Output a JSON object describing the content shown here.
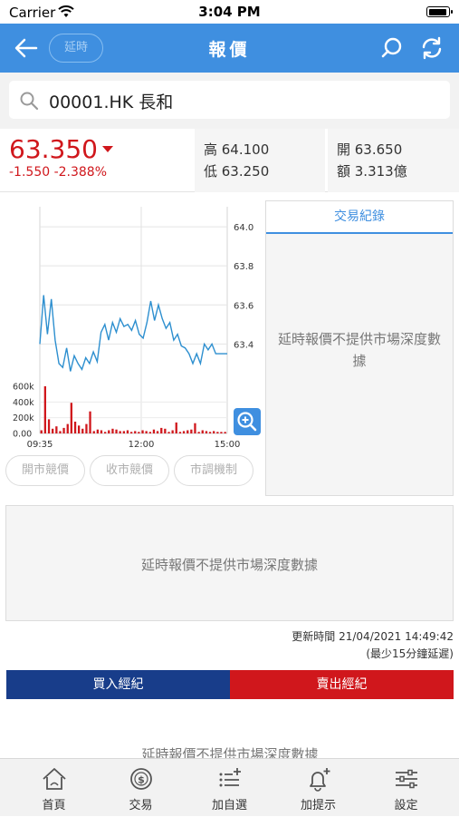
{
  "status_bar": {
    "carrier": "Carrier",
    "time": "3:04 PM"
  },
  "nav": {
    "delay_label": "延時",
    "title": "報價"
  },
  "search": {
    "value": "00001.HK 長和"
  },
  "quote": {
    "price": "63.350",
    "change": "-1.550 -2.388%",
    "high": "高 64.100",
    "low": "低 63.250",
    "open": "開 63.650",
    "turnover": "額 3.313億"
  },
  "chart_data": {
    "type": "line",
    "x_ticks": [
      "09:35",
      "12:00",
      "15:00"
    ],
    "price_ticks": [
      "64.0",
      "63.8",
      "63.6",
      "63.4"
    ],
    "volume_ticks": [
      "600k",
      "400k",
      "200k",
      "0.00"
    ],
    "price_ylim": [
      63.23,
      64.07
    ],
    "volume_ylim": [
      0,
      600000
    ],
    "price_series": [
      63.4,
      63.65,
      63.45,
      63.63,
      63.42,
      63.3,
      63.28,
      63.38,
      63.26,
      63.34,
      63.3,
      63.27,
      63.33,
      63.3,
      63.36,
      63.31,
      63.46,
      63.5,
      63.42,
      63.51,
      63.46,
      63.53,
      63.49,
      63.5,
      63.47,
      63.52,
      63.45,
      63.43,
      63.51,
      63.62,
      63.52,
      63.6,
      63.53,
      63.48,
      63.51,
      63.42,
      63.45,
      63.39,
      63.38,
      63.35,
      63.3,
      63.35,
      63.3,
      63.4,
      63.37,
      63.4,
      63.35,
      63.35,
      63.35,
      63.35
    ],
    "volume_series": [
      40000,
      620000,
      180000,
      60000,
      90000,
      30000,
      70000,
      120000,
      390000,
      150000,
      100000,
      60000,
      120000,
      280000,
      30000,
      50000,
      40000,
      20000,
      40000,
      60000,
      50000,
      30000,
      30000,
      40000,
      20000,
      30000,
      20000,
      40000,
      30000,
      20000,
      50000,
      30000,
      70000,
      60000,
      20000,
      40000,
      140000,
      20000,
      30000,
      40000,
      50000,
      130000,
      20000,
      40000,
      30000,
      20000,
      30000,
      20000,
      20000,
      20000
    ],
    "colors": {
      "price_line": "#2d8fcf",
      "volume_bar": "#d0171c"
    }
  },
  "buttons": {
    "opening_auction": "開市競價",
    "closing_auction": "收市競價",
    "vcm": "市調機制"
  },
  "trades": {
    "title": "交易紀錄",
    "message": "延時報價不提供市場深度數據"
  },
  "depth": {
    "message": "延時報價不提供市場深度數據"
  },
  "update": {
    "time": "更新時間 21/04/2021 14:49:42",
    "note": "(最少15分鐘延遲)"
  },
  "brokers": {
    "buy_label": "買入經紀",
    "sell_label": "賣出經紀",
    "message": "延時報價不提供市場深度數據"
  },
  "tabbar": {
    "items": [
      {
        "label": "首頁",
        "icon": "home-icon"
      },
      {
        "label": "交易",
        "icon": "trade-icon"
      },
      {
        "label": "加自選",
        "icon": "add-watchlist-icon"
      },
      {
        "label": "加提示",
        "icon": "add-alert-icon"
      },
      {
        "label": "設定",
        "icon": "settings-icon"
      }
    ]
  },
  "colors": {
    "accent": "#3f8fe0",
    "down": "#d0171c",
    "buy": "#183d8a"
  }
}
